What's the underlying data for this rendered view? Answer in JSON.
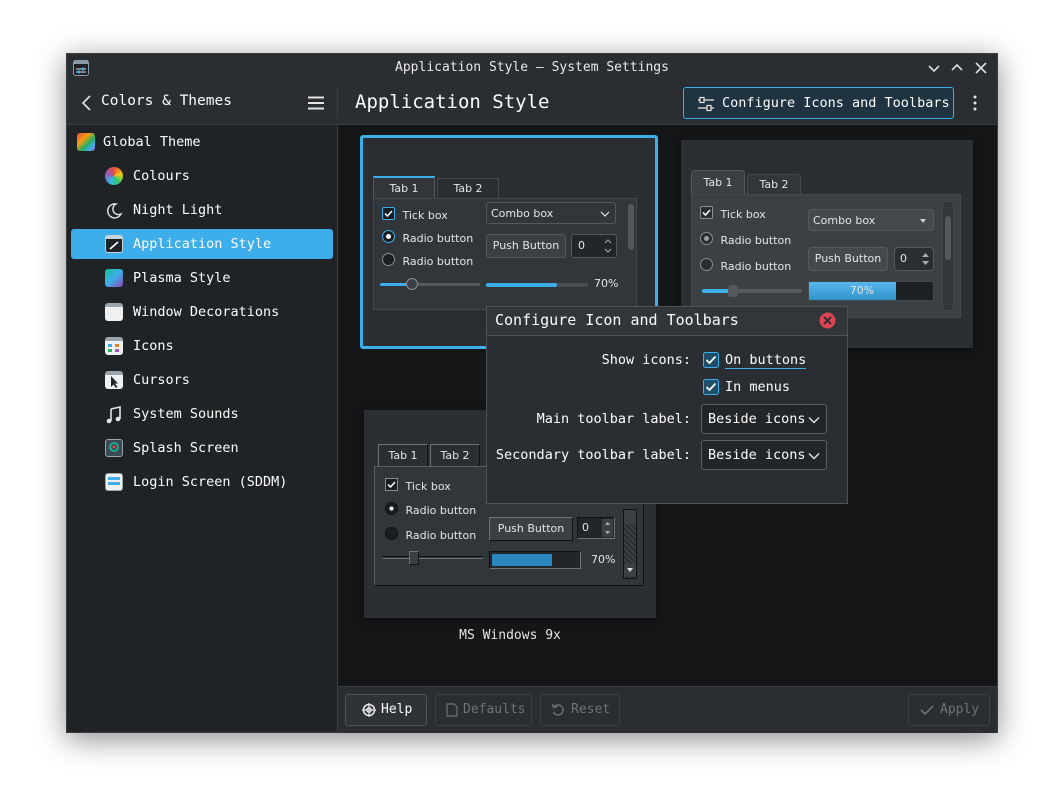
{
  "window": {
    "title": "Application Style — System Settings"
  },
  "header": {
    "back_label": "Colors & Themes",
    "page_title": "Application Style",
    "configure_button": "Configure Icons and Toolbars"
  },
  "sidebar": {
    "items": [
      {
        "label": "Global Theme"
      },
      {
        "label": "Colours"
      },
      {
        "label": "Night Light"
      },
      {
        "label": "Application Style"
      },
      {
        "label": "Plasma Style"
      },
      {
        "label": "Window Decorations"
      },
      {
        "label": "Icons"
      },
      {
        "label": "Cursors"
      },
      {
        "label": "System Sounds"
      },
      {
        "label": "Splash Screen"
      },
      {
        "label": "Login Screen (SDDM)"
      }
    ],
    "selected": "Application Style"
  },
  "previews": {
    "tab1": "Tab 1",
    "tab2": "Tab 2",
    "tick_box": "Tick box",
    "radio_button": "Radio button",
    "combo_box": "Combo box",
    "push_button": "Push Button",
    "spin_value": "0",
    "progress_label": "70%",
    "progress": 0.7,
    "bottom_caption": "MS Windows 9x"
  },
  "dialog": {
    "title": "Configure Icon and Toolbars",
    "show_icons_label": "Show icons:",
    "on_buttons": "On buttons",
    "in_menus": "In menus",
    "main_toolbar_label": "Main toolbar label:",
    "main_toolbar_value": "Beside icons",
    "secondary_toolbar_label": "Secondary toolbar label:",
    "secondary_toolbar_value": "Beside icons"
  },
  "footer": {
    "help": "Help",
    "defaults": "Defaults",
    "reset": "Reset",
    "apply": "Apply"
  },
  "colors": {
    "accent": "#3daee9",
    "close_red": "#da4453",
    "bg": "#202326"
  }
}
